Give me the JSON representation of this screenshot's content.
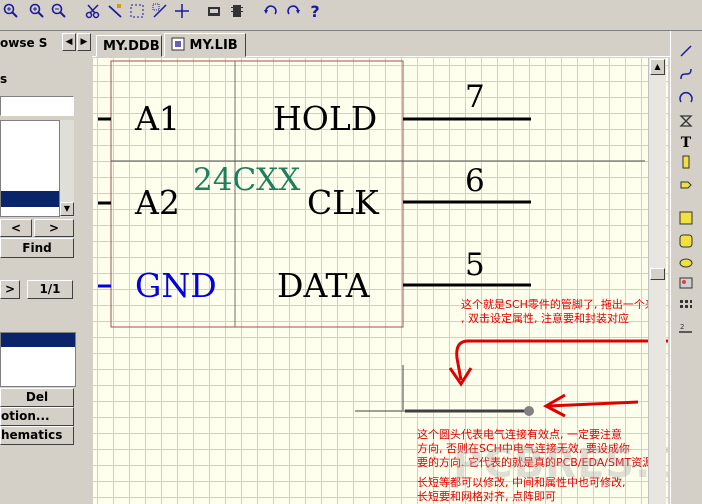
{
  "toolbar": {
    "icons": [
      "zoom-in-icon",
      "zoom-out-icon",
      "cut-icon",
      "wire-icon",
      "select-icon",
      "move-selection-icon",
      "move-icon",
      "library-icon",
      "chip-icon",
      "undo-icon",
      "redo-icon",
      "help-icon"
    ],
    "help_glyph": "?"
  },
  "left_panel": {
    "browse_label": "owse S",
    "header_fragment": "s",
    "prev_glyph": "<",
    "next_glyph": ">",
    "find_label": "Find",
    "pager_arrow": ">",
    "page_indicator": "1/1",
    "del_label": "Del",
    "option_label": "otion...",
    "schematics_label": "hematics"
  },
  "tabs": [
    {
      "label": "MY.DDB"
    },
    {
      "label": "MY.LIB"
    }
  ],
  "schematic": {
    "component_name": "24CXX",
    "pins_left": [
      {
        "label": "A1",
        "color": "#000000"
      },
      {
        "label": "A2",
        "color": "#000000"
      },
      {
        "label": "GND",
        "color": "#0000e0"
      }
    ],
    "pins_right": [
      {
        "label": "HOLD",
        "number": "7"
      },
      {
        "label": "CLK",
        "number": "6"
      },
      {
        "label": "DATA",
        "number": "5"
      }
    ],
    "annotation_1": {
      "line1": "这个就是SCH零件的管脚了, 拖出一个来",
      "line2": ", 双击设定属性, 注意要和封装对应"
    },
    "annotation_2": {
      "line1": "这个圆头代表电气连接有效点, 一定要注意",
      "line2": "方向, 否则在SCH中电气连接无效, 要设成你",
      "line3": "要的方向. 它代表的就是真的PCB/EDA/SMT资源网",
      "line4": "长短等都可以修改, 中间和属性中也可修改,",
      "line5": "长短要和网格对齐, 点阵即可"
    },
    "watermark": "PCBRES.COM"
  },
  "colors": {
    "accent_blue": "#0a246a",
    "component_green": "#1e7f5a",
    "component_border": "#a05050",
    "note_red": "#e00000"
  }
}
